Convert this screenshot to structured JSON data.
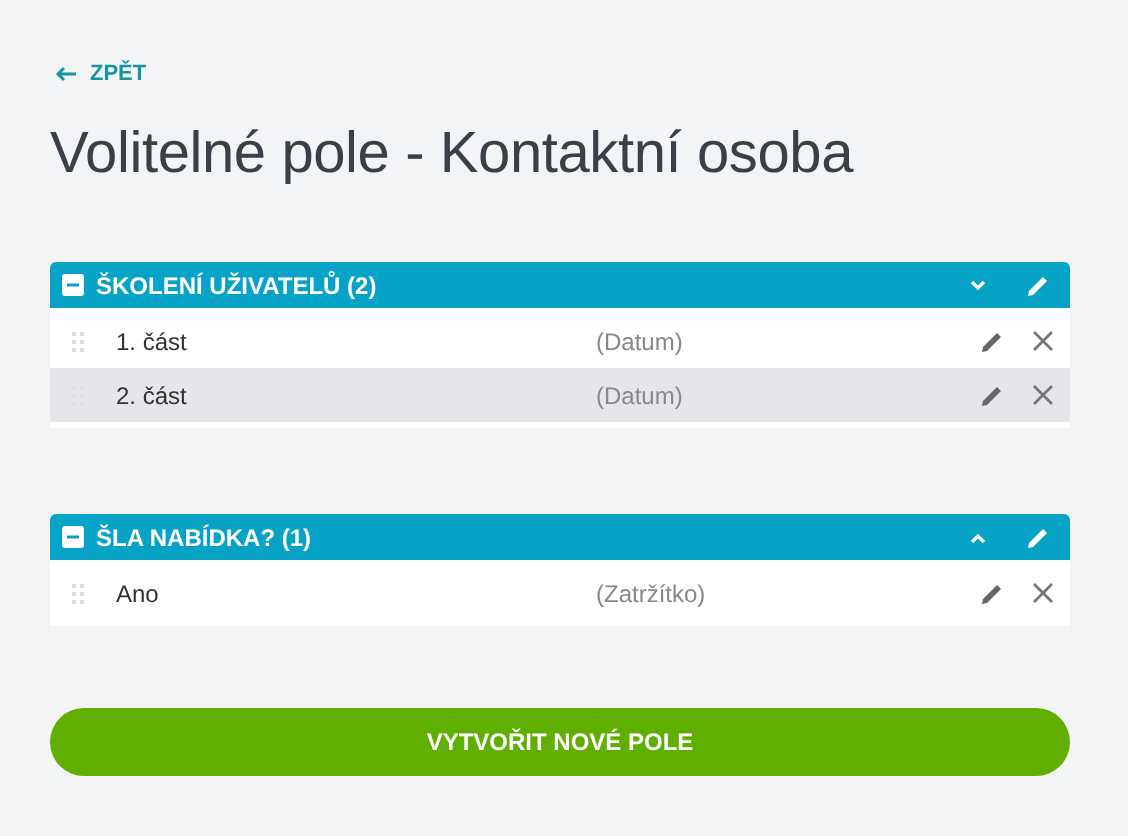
{
  "back_link": {
    "label": "ZPĚT"
  },
  "title": "Volitelné pole - Kontaktní osoba",
  "groups": [
    {
      "title": "ŠKOLENÍ UŽIVATELŮ (2)",
      "expanded": false,
      "fields": [
        {
          "name": "1. část",
          "type": "(Datum)",
          "highlighted": false
        },
        {
          "name": "2. část",
          "type": "(Datum)",
          "highlighted": true
        }
      ]
    },
    {
      "title": "ŠLA NABÍDKA? (1)",
      "expanded": true,
      "fields": [
        {
          "name": "Ano",
          "type": "(Zatržítko)",
          "highlighted": false
        }
      ]
    }
  ],
  "create_button": {
    "label": "VYTVOŘIT NOVÉ POLE"
  }
}
